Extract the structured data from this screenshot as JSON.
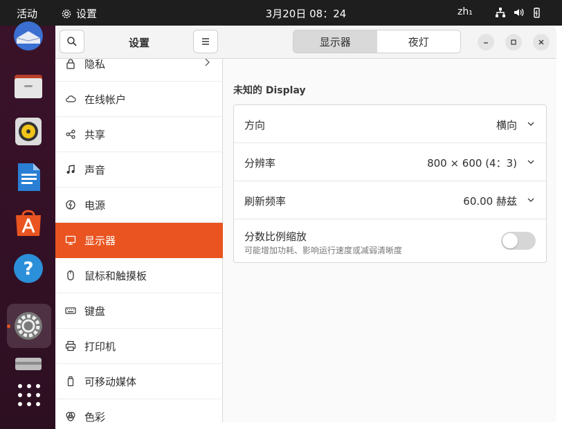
{
  "topbar": {
    "activities": "活动",
    "app_name": "设置",
    "clock": "3月20日  08：24",
    "input_method": "zh₁"
  },
  "dock": {
    "apps": [
      "thunderbird-icon",
      "files-icon",
      "rhythmbox-icon",
      "writer-icon",
      "app-center-icon",
      "help-icon",
      "settings-icon",
      "disk-icon"
    ],
    "running_indicator_color": "#e95420"
  },
  "settings": {
    "title": "设置",
    "sidebar": [
      {
        "label": "隐私",
        "icon": "privacy-lock-icon",
        "has_arrow": true
      },
      {
        "label": "在线帐户",
        "icon": "cloud-icon"
      },
      {
        "label": "共享",
        "icon": "share-icon"
      },
      {
        "label": "声音",
        "icon": "music-note-icon"
      },
      {
        "label": "电源",
        "icon": "power-icon"
      },
      {
        "label": "显示器",
        "icon": "display-icon",
        "active": true
      },
      {
        "label": "鼠标和触摸板",
        "icon": "mouse-icon"
      },
      {
        "label": "键盘",
        "icon": "keyboard-icon"
      },
      {
        "label": "打印机",
        "icon": "printer-icon"
      },
      {
        "label": "可移动媒体",
        "icon": "removable-media-icon"
      },
      {
        "label": "色彩",
        "icon": "color-icon"
      }
    ]
  },
  "header": {
    "tabs": [
      {
        "label": "显示器",
        "active": true
      },
      {
        "label": "夜灯",
        "active": false
      }
    ]
  },
  "display": {
    "section_title": "未知的 Display",
    "orientation": {
      "label": "方向",
      "value": "横向"
    },
    "resolution": {
      "label": "分辨率",
      "value": "800 × 600 (4：3)"
    },
    "refresh": {
      "label": "刷新频率",
      "value": "60.00 赫兹"
    },
    "scaling": {
      "label": "分数比例缩放",
      "subtitle": "可能增加功耗、影响运行速度或减弱清晰度",
      "enabled": false
    }
  },
  "colors": {
    "accent": "#e95420",
    "topbar": "#1e1e1e",
    "dock": "#3a1229"
  }
}
